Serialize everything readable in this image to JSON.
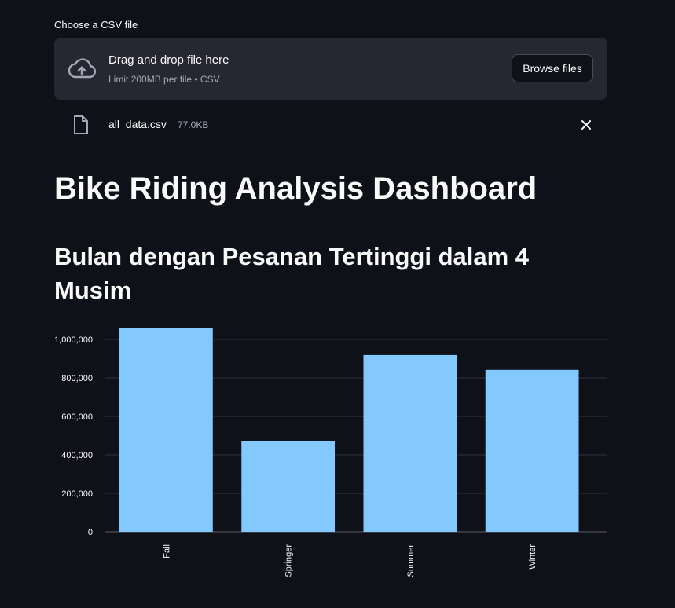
{
  "uploader": {
    "label": "Choose a CSV file",
    "drop_title": "Drag and drop file here",
    "drop_limit": "Limit 200MB per file • CSV",
    "browse_label": "Browse files",
    "icon": "cloud-upload-icon"
  },
  "file": {
    "name": "all_data.csv",
    "size": "77.0KB",
    "icon": "file-icon",
    "remove_icon": "close-icon"
  },
  "page_title": "Bike Riding Analysis Dashboard",
  "section_title": "Bulan dengan Pesanan Tertinggi dalam 4 Musim",
  "colors": {
    "background": "#0e1117",
    "panel": "#262730",
    "bar": "#83c9ff",
    "text": "#fafafa",
    "muted": "#a3a8b8"
  },
  "chart_data": {
    "type": "bar",
    "categories": [
      "Fall",
      "Springer",
      "Summer",
      "Winter"
    ],
    "values": [
      1061129,
      471348,
      918589,
      841613
    ],
    "yticks": [
      "0",
      "200,000",
      "400,000",
      "600,000",
      "800,000",
      "1,000,000"
    ],
    "ytick_values": [
      0,
      200000,
      400000,
      600000,
      800000,
      1000000
    ],
    "ylim": [
      0,
      1061129
    ],
    "grid": true,
    "xlabel": "",
    "ylabel": ""
  }
}
